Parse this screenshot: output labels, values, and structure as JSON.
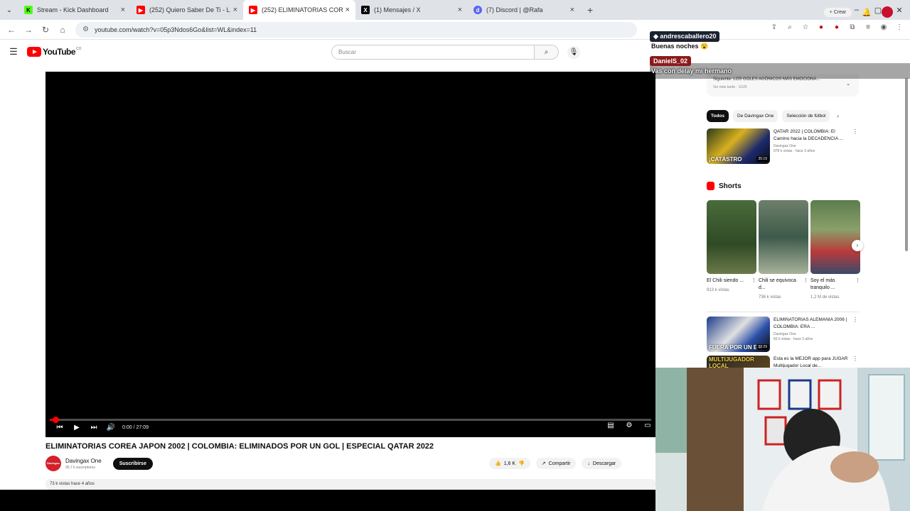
{
  "browser": {
    "tabs": [
      {
        "title": "Stream - Kick Dashboard",
        "favicon_color": "#53fc18",
        "active": false
      },
      {
        "title": "(252) Quiero Saber De Ti - Los I",
        "favicon_color": "#ff0000",
        "active": false
      },
      {
        "title": "(252) ELIMINATORIAS COREA JA",
        "favicon_color": "#ff0000",
        "active": true
      },
      {
        "title": "(1) Mensajes / X",
        "favicon_color": "#000000",
        "active": false
      },
      {
        "title": "(7) Discord | @Rafa",
        "favicon_color": "#5865f2",
        "active": false
      }
    ],
    "url": "youtube.com/watch?v=05p3Ndos6Go&list=WL&index=11"
  },
  "youtube": {
    "logo_text": "YouTube",
    "logo_region": "CO",
    "search_placeholder": "Buscar",
    "create_label": "Crear",
    "notif_count": "9+",
    "player": {
      "time": "0:00 / 27:09",
      "progress_fraction": 0.01
    },
    "video": {
      "title": "ELIMINATORIAS COREA JAPON 2002 | COLOMBIA: ELIMINADOS POR UN GOL | ESPECIAL QATAR 2022",
      "channel": "Davingax One",
      "channel_avatar_text": "Davingax ONE",
      "subscribers": "95,7 k suscriptores",
      "subscribe_label": "Suscribirse",
      "likes": "1,6 K",
      "share_label": "Compartir",
      "download_label": "Descargar",
      "views_age": "73 k vistas  hace 4 años"
    },
    "sidebar": {
      "next_title": "Siguiente: LOS GOLES AGÓNICOS MÁS EMOCIONA...",
      "next_sub": "Ver más tarde · 11/25",
      "chips": [
        "Todos",
        "De Davingax One",
        "Selección de fútbol"
      ],
      "videos": [
        {
          "title": "QATAR 2022 | COLOMBIA: El Camino hacia la DECADENCIA ...",
          "channel": "Davingax One",
          "views": "978 k vistas · hace 3 años",
          "thumb_caption": "¡CATÁSTRO",
          "duration": "35:19"
        },
        {
          "title": "ELIMINATORIAS ALEMANIA 2006 | COLOMBIA: ERA ...",
          "channel": "Davingax One",
          "views": "83 k vistas · hace 3 años",
          "thumb_caption": "FUERA POR UN EM",
          "duration": "32:29"
        },
        {
          "title": "Esta es la MEJOR app para JUGAR Multijugador Local de...",
          "channel": "",
          "views": "",
          "thumb_caption": "MULTIJUGADOR LOCAL",
          "duration": ""
        }
      ],
      "shorts_label": "Shorts",
      "shorts": [
        {
          "title": "El Chili siendo ...",
          "views": "913 k vistas"
        },
        {
          "title": "Chili se equivoca d...",
          "views": "736 k vistas"
        },
        {
          "title": "Soy el más tranquilo ...",
          "views": "1,2 M de vistas"
        }
      ]
    }
  },
  "chat": [
    {
      "user": "andrescaballero20",
      "message": "Buenas noches 😮"
    },
    {
      "user": "DanielS_02",
      "message": "Vas con delay mi hermano"
    }
  ]
}
